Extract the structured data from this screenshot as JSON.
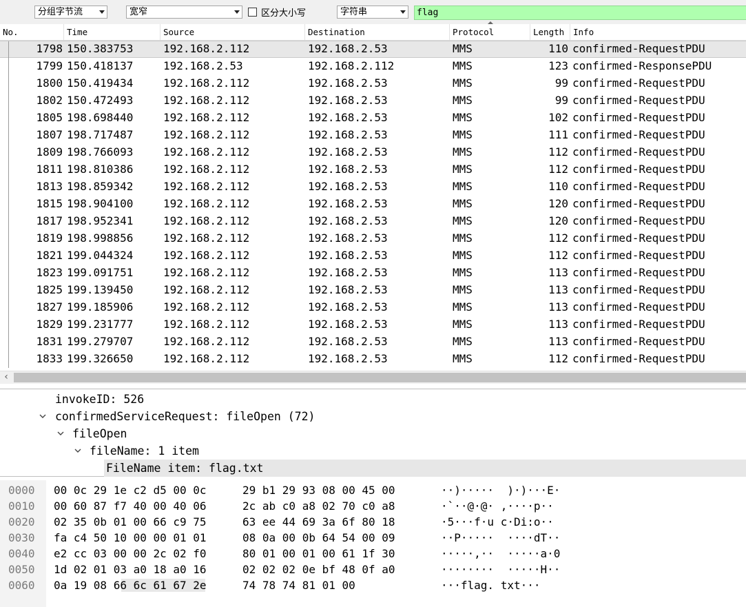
{
  "findbar": {
    "search_in": "分组字节流",
    "char_width": "宽窄",
    "case_label": "区分大小写",
    "search_type": "字符串",
    "filter_text": "flag"
  },
  "columns": [
    "No.",
    "Time",
    "Source",
    "Destination",
    "Protocol",
    "Length",
    "Info"
  ],
  "packets": [
    {
      "no": "1798",
      "time": "150.383753",
      "src": "192.168.2.112",
      "dst": "192.168.2.53",
      "proto": "MMS",
      "len": "110",
      "info": "confirmed-RequestPDU"
    },
    {
      "no": "1799",
      "time": "150.418137",
      "src": "192.168.2.53",
      "dst": "192.168.2.112",
      "proto": "MMS",
      "len": "123",
      "info": "confirmed-ResponsePDU"
    },
    {
      "no": "1800",
      "time": "150.419434",
      "src": "192.168.2.112",
      "dst": "192.168.2.53",
      "proto": "MMS",
      "len": "99",
      "info": "confirmed-RequestPDU"
    },
    {
      "no": "1802",
      "time": "150.472493",
      "src": "192.168.2.112",
      "dst": "192.168.2.53",
      "proto": "MMS",
      "len": "99",
      "info": "confirmed-RequestPDU"
    },
    {
      "no": "1805",
      "time": "198.698440",
      "src": "192.168.2.112",
      "dst": "192.168.2.53",
      "proto": "MMS",
      "len": "102",
      "info": "confirmed-RequestPDU"
    },
    {
      "no": "1807",
      "time": "198.717487",
      "src": "192.168.2.112",
      "dst": "192.168.2.53",
      "proto": "MMS",
      "len": "111",
      "info": "confirmed-RequestPDU"
    },
    {
      "no": "1809",
      "time": "198.766093",
      "src": "192.168.2.112",
      "dst": "192.168.2.53",
      "proto": "MMS",
      "len": "112",
      "info": "confirmed-RequestPDU"
    },
    {
      "no": "1811",
      "time": "198.810386",
      "src": "192.168.2.112",
      "dst": "192.168.2.53",
      "proto": "MMS",
      "len": "112",
      "info": "confirmed-RequestPDU"
    },
    {
      "no": "1813",
      "time": "198.859342",
      "src": "192.168.2.112",
      "dst": "192.168.2.53",
      "proto": "MMS",
      "len": "110",
      "info": "confirmed-RequestPDU"
    },
    {
      "no": "1815",
      "time": "198.904100",
      "src": "192.168.2.112",
      "dst": "192.168.2.53",
      "proto": "MMS",
      "len": "120",
      "info": "confirmed-RequestPDU"
    },
    {
      "no": "1817",
      "time": "198.952341",
      "src": "192.168.2.112",
      "dst": "192.168.2.53",
      "proto": "MMS",
      "len": "120",
      "info": "confirmed-RequestPDU"
    },
    {
      "no": "1819",
      "time": "198.998856",
      "src": "192.168.2.112",
      "dst": "192.168.2.53",
      "proto": "MMS",
      "len": "112",
      "info": "confirmed-RequestPDU"
    },
    {
      "no": "1821",
      "time": "199.044324",
      "src": "192.168.2.112",
      "dst": "192.168.2.53",
      "proto": "MMS",
      "len": "112",
      "info": "confirmed-RequestPDU"
    },
    {
      "no": "1823",
      "time": "199.091751",
      "src": "192.168.2.112",
      "dst": "192.168.2.53",
      "proto": "MMS",
      "len": "113",
      "info": "confirmed-RequestPDU"
    },
    {
      "no": "1825",
      "time": "199.139450",
      "src": "192.168.2.112",
      "dst": "192.168.2.53",
      "proto": "MMS",
      "len": "113",
      "info": "confirmed-RequestPDU"
    },
    {
      "no": "1827",
      "time": "199.185906",
      "src": "192.168.2.112",
      "dst": "192.168.2.53",
      "proto": "MMS",
      "len": "113",
      "info": "confirmed-RequestPDU"
    },
    {
      "no": "1829",
      "time": "199.231777",
      "src": "192.168.2.112",
      "dst": "192.168.2.53",
      "proto": "MMS",
      "len": "113",
      "info": "confirmed-RequestPDU"
    },
    {
      "no": "1831",
      "time": "199.279707",
      "src": "192.168.2.112",
      "dst": "192.168.2.53",
      "proto": "MMS",
      "len": "113",
      "info": "confirmed-RequestPDU"
    },
    {
      "no": "1833",
      "time": "199.326650",
      "src": "192.168.2.112",
      "dst": "192.168.2.53",
      "proto": "MMS",
      "len": "112",
      "info": "confirmed-RequestPDU"
    }
  ],
  "selected_packet": "1798",
  "detail": {
    "invoke_id": "invokeID: 526",
    "service_request": "confirmedServiceRequest: fileOpen (72)",
    "file_open": "fileOpen",
    "file_name": "fileName: 1 item",
    "file_name_item": "FileName item: flag.txt"
  },
  "hex_rows": [
    {
      "off": "0000",
      "b1": "00 0c 29 1e c2 d5 00 0c",
      "b2": "29 b1 29 93 08 00 45 00",
      "ascii": "··)·····  )·)···E·"
    },
    {
      "off": "0010",
      "b1": "00 60 87 f7 40 00 40 06",
      "b2": "2c ab c0 a8 02 70 c0 a8",
      "ascii": "·`··@·@· ,····p··"
    },
    {
      "off": "0020",
      "b1": "02 35 0b 01 00 66 c9 75",
      "b2": "63 ee 44 69 3a 6f 80 18",
      "ascii": "·5···f·u c·Di:o··"
    },
    {
      "off": "0030",
      "b1": "fa c4 50 10 00 00 01 01",
      "b2": "08 0a 00 0b 64 54 00 09",
      "ascii": "··P·····  ····dT··"
    },
    {
      "off": "0040",
      "b1": "e2 cc 03 00 00 2c 02 f0",
      "b2": "80 01 00 01 00 61 1f 30",
      "ascii": "·····,··  ·····a·0"
    },
    {
      "off": "0050",
      "b1": "1d 02 01 03 a0 18 a0 16",
      "b2": "02 02 02 0e bf 48 0f a0",
      "ascii": "········  ·····H··"
    },
    {
      "off": "0060",
      "b1": "0a 19 08 66 6c 61 67 2e",
      "b2": "74 78 74 81 01 00",
      "ascii": "···flag. txt···"
    }
  ]
}
